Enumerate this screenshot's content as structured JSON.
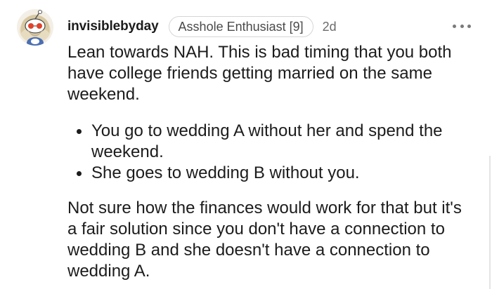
{
  "comment": {
    "username": "invisiblebyday",
    "flair": "Asshole Enthusiast [9]",
    "age": "2d",
    "avatar_icon": "snoo-avatar-icon",
    "more_icon": "more-options-icon",
    "paragraph_1": "Lean towards NAH. This is bad timing that you both have college friends getting married on the same weekend.",
    "bullets": [
      "You go to wedding A without her and spend the weekend.",
      "She goes to wedding B without you."
    ],
    "paragraph_2": "Not sure how the finances would work for that but it's a fair solution since you don't have a connection to wedding B and she doesn't have a connection to wedding A."
  },
  "colors": {
    "text": "#1c1c1c",
    "meta": "#6b6b6b",
    "flair_border": "#d6d6d6"
  }
}
